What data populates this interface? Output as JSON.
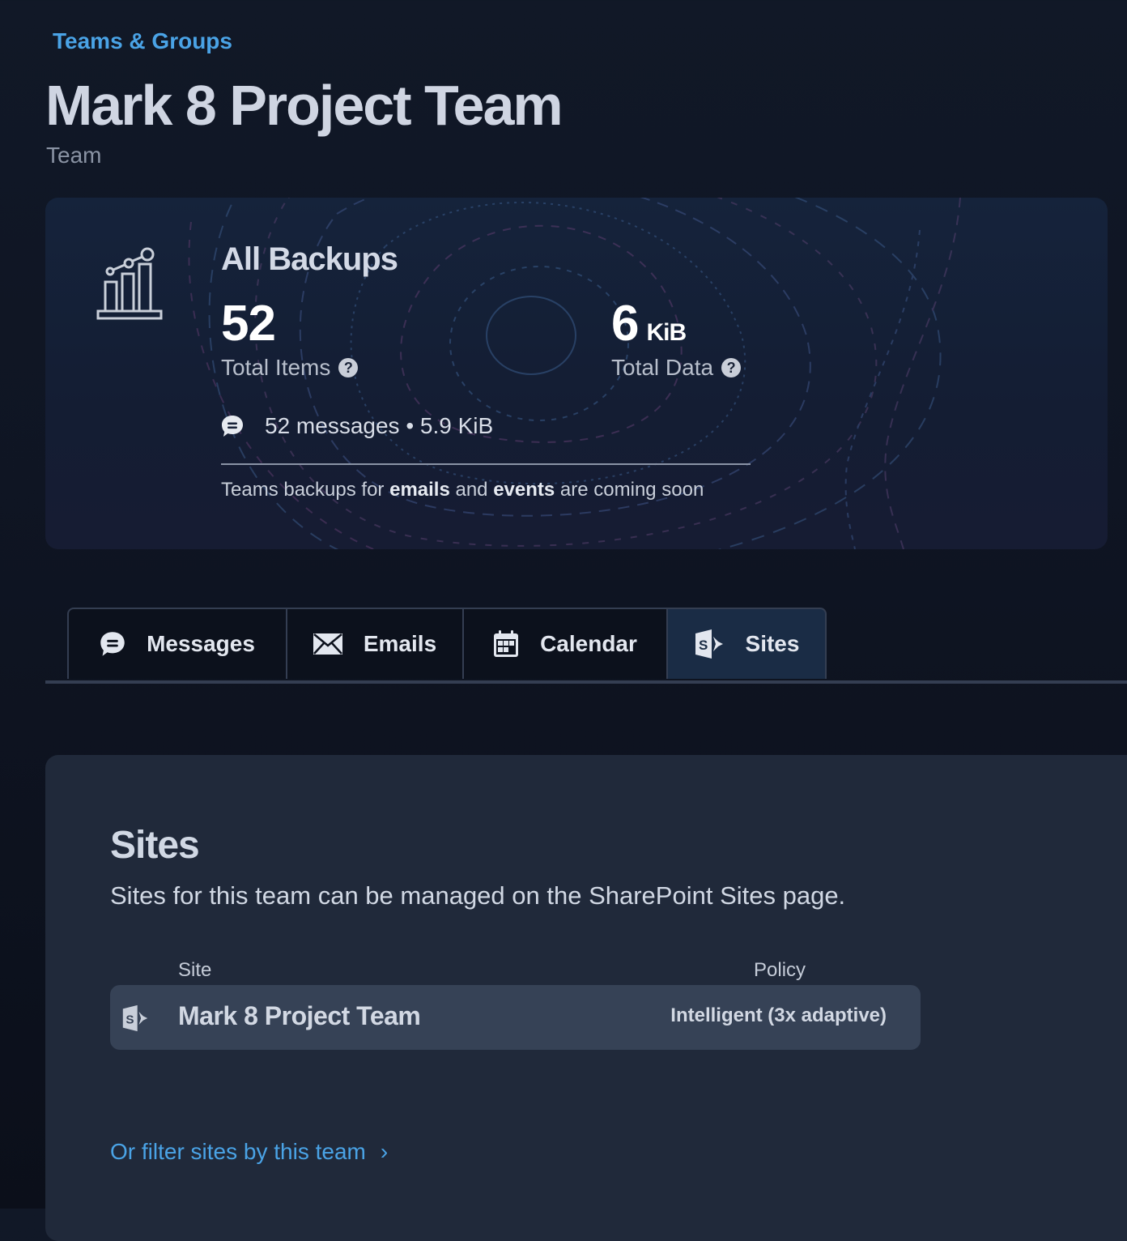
{
  "breadcrumb": {
    "label": "Teams & Groups"
  },
  "header": {
    "title": "Mark 8 Project Team",
    "subtitle": "Team"
  },
  "backups": {
    "title": "All Backups",
    "total_items": {
      "value": "52",
      "label": "Total Items"
    },
    "total_data": {
      "value": "6",
      "unit": "KiB",
      "label": "Total Data"
    },
    "messages_summary": "52 messages • 5.9 KiB",
    "coming_soon": {
      "prefix": "Teams backups for ",
      "b1": "emails",
      "mid": " and ",
      "b2": "events",
      "suffix": " are coming soon"
    }
  },
  "tabs": [
    {
      "label": "Messages",
      "icon": "chat-bubble-icon",
      "active": false
    },
    {
      "label": "Emails",
      "icon": "envelope-icon",
      "active": false
    },
    {
      "label": "Calendar",
      "icon": "calendar-icon",
      "active": false
    },
    {
      "label": "Sites",
      "icon": "sharepoint-icon",
      "active": true
    }
  ],
  "sites": {
    "title": "Sites",
    "description": "Sites for this team can be managed on the SharePoint Sites page.",
    "columns": {
      "site": "Site",
      "policy": "Policy"
    },
    "rows": [
      {
        "name": "Mark 8 Project Team",
        "policy": "Intelligent (3x adaptive)"
      }
    ],
    "filter_link": "Or filter sites by this team"
  },
  "colors": {
    "accent": "#4aa3e6",
    "active_tab": "#1a2c45",
    "panel": "#20293a"
  }
}
